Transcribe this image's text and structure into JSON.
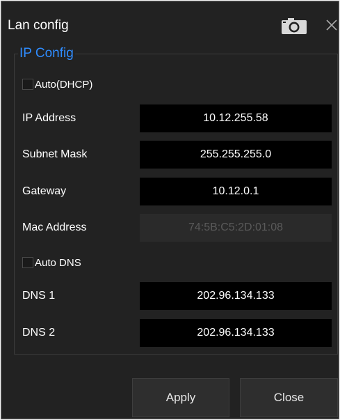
{
  "dialog": {
    "title": "Lan config",
    "icons": {
      "camera": "camera-icon",
      "close": "close-icon"
    }
  },
  "ip_config": {
    "legend": "IP Config",
    "auto_dhcp": {
      "label": "Auto(DHCP)",
      "checked": false
    },
    "ip_address": {
      "label": "IP Address",
      "value": "10.12.255.58"
    },
    "subnet_mask": {
      "label": "Subnet Mask",
      "value": "255.255.255.0"
    },
    "gateway": {
      "label": "Gateway",
      "value": "10.12.0.1"
    },
    "mac_address": {
      "label": "Mac Address",
      "value": "74:5B:C5:2D:01:08"
    },
    "auto_dns": {
      "label": "Auto DNS",
      "checked": false
    },
    "dns1": {
      "label": "DNS 1",
      "value": "202.96.134.133"
    },
    "dns2": {
      "label": "DNS 2",
      "value": "202.96.134.133"
    }
  },
  "buttons": {
    "apply": "Apply",
    "close": "Close"
  },
  "colors": {
    "dialog_background": "#222222",
    "legend_accent": "#2f8cff",
    "input_background": "#000000",
    "disabled_input_background": "#2a2a2a",
    "disabled_text": "#5a5a5a"
  }
}
